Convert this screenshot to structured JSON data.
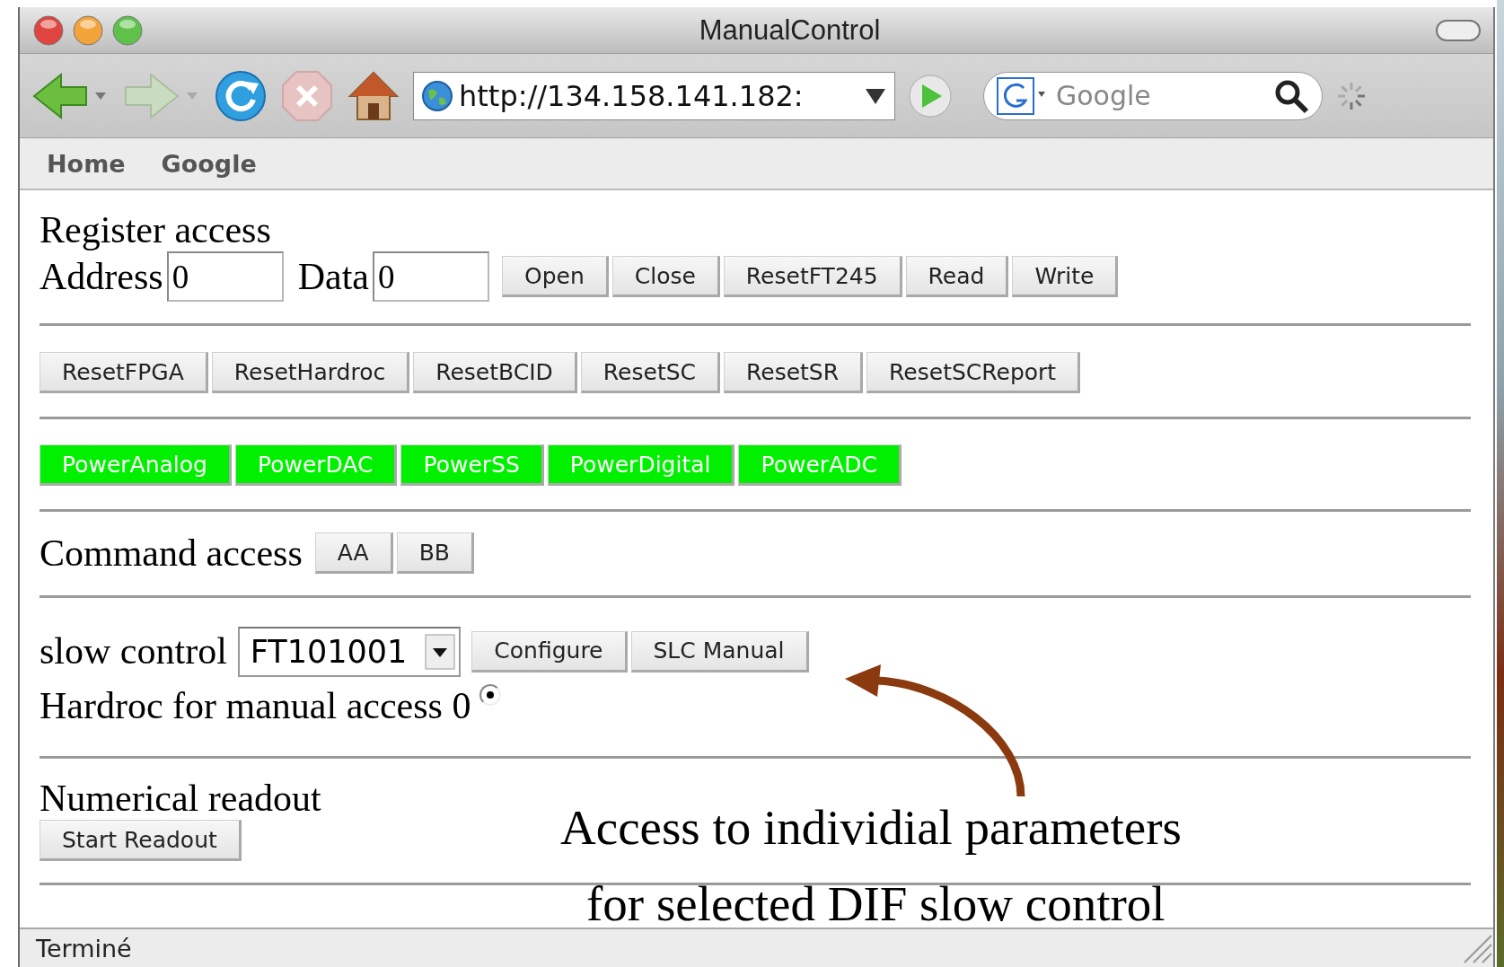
{
  "window": {
    "title": "ManualControl"
  },
  "toolbar": {
    "url": "http://134.158.141.182:",
    "search": {
      "placeholder": "Google"
    }
  },
  "bookmarks": [
    "Home",
    "Google"
  ],
  "register_access": {
    "heading": "Register access",
    "fields": [
      {
        "label": "Address",
        "value": "0"
      },
      {
        "label": "Data",
        "value": "0"
      }
    ],
    "buttons": [
      "Open",
      "Close",
      "ResetFT245",
      "Read",
      "Write"
    ]
  },
  "reset_buttons": [
    "ResetFPGA",
    "ResetHardroc",
    "ResetBCID",
    "ResetSC",
    "ResetSR",
    "ResetSCReport"
  ],
  "power_buttons": [
    {
      "label": "PowerAnalog",
      "on": true
    },
    {
      "label": "PowerDAC",
      "on": true
    },
    {
      "label": "PowerSS",
      "on": true
    },
    {
      "label": "PowerDigital",
      "on": true
    },
    {
      "label": "PowerADC",
      "on": true
    }
  ],
  "command_access": {
    "label": "Command access",
    "buttons": [
      "AA",
      "BB"
    ]
  },
  "slow_control": {
    "label": "slow control",
    "select": {
      "value": "FT101001"
    },
    "buttons": [
      "Configure",
      "SLC Manual"
    ],
    "radio": {
      "label": "Hardroc for manual access 0",
      "checked": true
    }
  },
  "numerical_readout": {
    "heading": "Numerical readout",
    "buttons": [
      "Start Readout"
    ]
  },
  "annotation": {
    "lines": [
      "Access to individial parameters",
      "for selected DIF slow control"
    ]
  },
  "status_bar": {
    "text": "Terminé"
  }
}
